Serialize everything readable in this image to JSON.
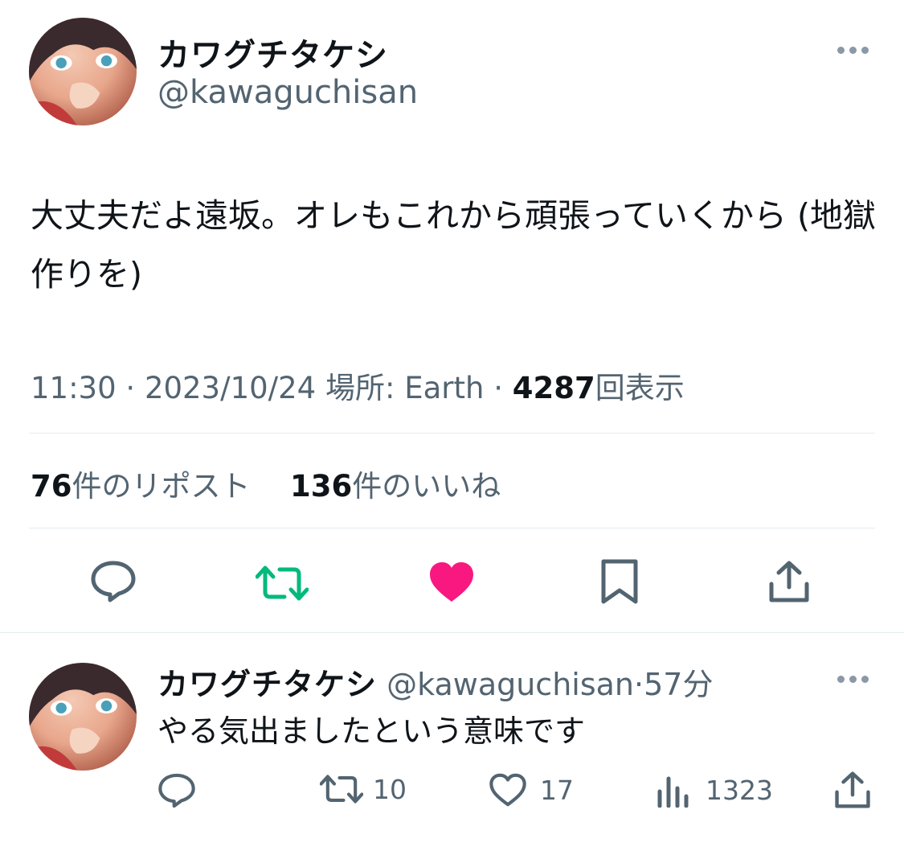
{
  "tweet": {
    "display_name": "カワグチタケシ",
    "handle": "@kawaguchisan",
    "text": "大丈夫だよ遠坂。オレもこれから頑張っていくから (地獄作りを)",
    "time": "11:30",
    "date": "2023/10/24",
    "location_label": "場所: Earth",
    "views_count": "4287",
    "views_label": "回表示",
    "reposts_count": "76",
    "reposts_label": "件のリポスト",
    "likes_count": "136",
    "likes_label": "件のいいね",
    "icons": [
      "more-icon",
      "reply-icon",
      "repost-icon",
      "like-icon",
      "bookmark-icon",
      "share-icon"
    ],
    "colors": {
      "repost": "#00ba7c",
      "like": "#f91880",
      "secondary_text": "#536471"
    }
  },
  "reply": {
    "display_name": "カワグチタケシ",
    "handle": "@kawaguchisan",
    "time_ago": "57分",
    "text": "やる気出ましたという意味です",
    "reposts_count": "10",
    "likes_count": "17",
    "views_count": "1323",
    "icons": [
      "more-icon",
      "reply-icon",
      "repost-icon",
      "like-icon",
      "views-icon",
      "share-icon"
    ]
  }
}
